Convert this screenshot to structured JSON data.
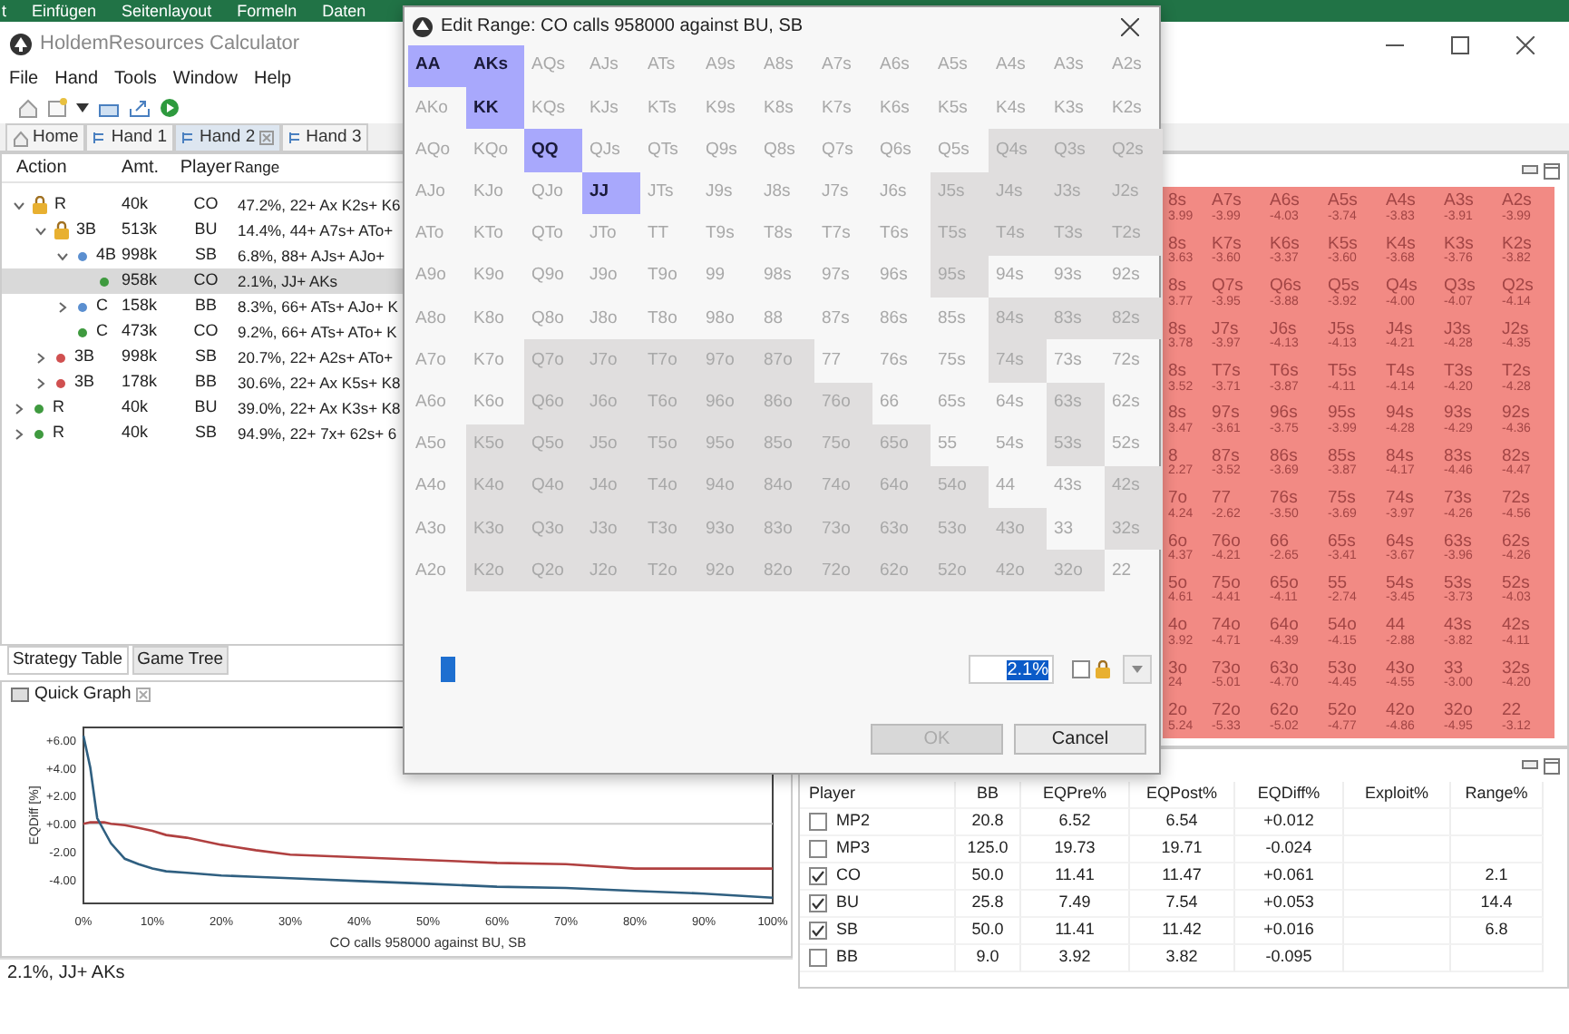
{
  "excel_ribbon": {
    "tabs": [
      "t",
      "Einfügen",
      "Seitenlayout",
      "Formeln",
      "Daten"
    ]
  },
  "window": {
    "title": "HoldemResources Calculator"
  },
  "menu": [
    "File",
    "Hand",
    "Tools",
    "Window",
    "Help"
  ],
  "tabs": [
    {
      "label": "Home",
      "kind": "home",
      "selected": false
    },
    {
      "label": "Hand 1",
      "kind": "hand",
      "selected": false
    },
    {
      "label": "Hand 2",
      "kind": "hand",
      "selected": true
    },
    {
      "label": "Hand 3",
      "kind": "hand",
      "selected": false
    }
  ],
  "action_tree": {
    "columns": [
      "Action",
      "Amt.",
      "Player",
      "Range"
    ],
    "rows": [
      {
        "action": "R",
        "amount": "40k",
        "player": "CO",
        "range": "47.2%, 22+ Ax K2s+ K6",
        "kind": "lock",
        "expanded": true,
        "selected": false,
        "children": [
          {
            "action": "3B",
            "amount": "513k",
            "player": "BU",
            "range": "14.4%, 44+ A7s+ ATo+",
            "kind": "lock",
            "expanded": true,
            "selected": false,
            "children": [
              {
                "action": "4B",
                "amount": "998k",
                "player": "SB",
                "range": "6.8%, 88+ AJs+ AJo+",
                "kind": "dot",
                "color": "#5b8fd0",
                "expanded": true,
                "selected": false,
                "children": [
                  {
                    "amount": "958k",
                    "player": "CO",
                    "range": "2.1%, JJ+ AKs",
                    "kind": "dot",
                    "color": "#3f9a3f",
                    "selected": true
                  }
                ]
              },
              {
                "action": "C",
                "amount": "158k",
                "player": "BB",
                "range": "8.3%, 66+ ATs+ AJo+ K",
                "kind": "dot",
                "color": "#5b8fd0",
                "expanded": false,
                "selected": false
              },
              {
                "action": "C",
                "amount": "473k",
                "player": "CO",
                "range": "9.2%, 66+ ATs+ ATo+ K",
                "kind": "dot",
                "color": "#3f9a3f",
                "selected": false
              }
            ]
          },
          {
            "action": "3B",
            "amount": "998k",
            "player": "SB",
            "range": "20.7%, 22+ A2s+ ATo+",
            "kind": "dot",
            "color": "#d05050",
            "expanded": false,
            "selected": false
          },
          {
            "action": "3B",
            "amount": "178k",
            "player": "BB",
            "range": "30.6%, 22+ Ax K5s+ K8",
            "kind": "dot",
            "color": "#d05050",
            "expanded": false,
            "selected": false
          }
        ]
      },
      {
        "action": "R",
        "amount": "40k",
        "player": "BU",
        "range": "39.0%, 22+ Ax K3s+ K8",
        "kind": "dot",
        "color": "#3f9a3f",
        "expanded": false,
        "selected": false
      },
      {
        "action": "R",
        "amount": "40k",
        "player": "SB",
        "range": "94.9%, 22+ 7x+ 62s+ 6",
        "kind": "dot",
        "color": "#3f9a3f",
        "expanded": false,
        "selected": false
      }
    ]
  },
  "bottom_tabs": [
    {
      "label": "Strategy Table",
      "selected": true
    },
    {
      "label": "Game Tree",
      "selected": false
    }
  ],
  "quick_graph": {
    "title": "Quick Graph",
    "chart_data": {
      "type": "line",
      "xlabel": "CO calls 958000 against BU, SB",
      "ylabel": "EQDiff [%]",
      "x": [
        0,
        1,
        2,
        3,
        4,
        6,
        8,
        10,
        12,
        15,
        20,
        25,
        30,
        40,
        50,
        60,
        70,
        80,
        90,
        100
      ],
      "series": [
        {
          "color": "#b04040",
          "values": [
            0,
            0.1,
            0.1,
            0.1,
            0,
            -0.1,
            -0.3,
            -0.5,
            -0.8,
            -1.0,
            -1.5,
            -1.9,
            -2.2,
            -2.4,
            -2.6,
            -2.8,
            -2.9,
            -3.2,
            -3.2,
            -3.2
          ]
        },
        {
          "color": "#2f5f80",
          "values": [
            6.3,
            4.0,
            0.4,
            -0.5,
            -1.4,
            -2.5,
            -2.9,
            -3.2,
            -3.4,
            -3.5,
            -3.7,
            -3.8,
            -3.9,
            -4.1,
            -4.3,
            -4.5,
            -4.6,
            -4.8,
            -5.0,
            -5.3
          ]
        }
      ],
      "xlim": [
        0,
        100
      ],
      "ylim": [
        -5.7,
        6.9
      ],
      "xticks": [
        {
          "value": 0,
          "label": "0%"
        },
        {
          "value": 10,
          "label": "10%"
        },
        {
          "value": 20,
          "label": "20%"
        },
        {
          "value": 30,
          "label": "30%"
        },
        {
          "value": 40,
          "label": "40%"
        },
        {
          "value": 50,
          "label": "50%"
        },
        {
          "value": 60,
          "label": "60%"
        },
        {
          "value": 70,
          "label": "70%"
        },
        {
          "value": 80,
          "label": "80%"
        },
        {
          "value": 90,
          "label": "90%"
        },
        {
          "value": 100,
          "label": "100%"
        }
      ],
      "yticks": [
        {
          "value": 6,
          "label": "+6.00"
        },
        {
          "value": 4,
          "label": "+4.00"
        },
        {
          "value": 2,
          "label": "+2.00"
        },
        {
          "value": 0,
          "label": "+0.00"
        },
        {
          "value": -2,
          "label": "-2.00"
        },
        {
          "value": -4,
          "label": "-4.00"
        }
      ]
    }
  },
  "status_bar": "2.1%, JJ+ AKs",
  "ev_grid": {
    "rows": [
      [
        {
          "hand": "8s",
          "value": "3.99"
        },
        {
          "hand": "A7s",
          "value": "-3.99"
        },
        {
          "hand": "A6s",
          "value": "-4.03"
        },
        {
          "hand": "A5s",
          "value": "-3.74"
        },
        {
          "hand": "A4s",
          "value": "-3.83"
        },
        {
          "hand": "A3s",
          "value": "-3.91"
        },
        {
          "hand": "A2s",
          "value": "-3.99"
        }
      ],
      [
        {
          "hand": "8s",
          "value": "3.63"
        },
        {
          "hand": "K7s",
          "value": "-3.60"
        },
        {
          "hand": "K6s",
          "value": "-3.37"
        },
        {
          "hand": "K5s",
          "value": "-3.60"
        },
        {
          "hand": "K4s",
          "value": "-3.68"
        },
        {
          "hand": "K3s",
          "value": "-3.76"
        },
        {
          "hand": "K2s",
          "value": "-3.82"
        }
      ],
      [
        {
          "hand": "8s",
          "value": "3.77"
        },
        {
          "hand": "Q7s",
          "value": "-3.95"
        },
        {
          "hand": "Q6s",
          "value": "-3.88"
        },
        {
          "hand": "Q5s",
          "value": "-3.92"
        },
        {
          "hand": "Q4s",
          "value": "-4.00"
        },
        {
          "hand": "Q3s",
          "value": "-4.07"
        },
        {
          "hand": "Q2s",
          "value": "-4.14"
        }
      ],
      [
        {
          "hand": "8s",
          "value": "3.78"
        },
        {
          "hand": "J7s",
          "value": "-3.97"
        },
        {
          "hand": "J6s",
          "value": "-4.13"
        },
        {
          "hand": "J5s",
          "value": "-4.13"
        },
        {
          "hand": "J4s",
          "value": "-4.21"
        },
        {
          "hand": "J3s",
          "value": "-4.28"
        },
        {
          "hand": "J2s",
          "value": "-4.35"
        }
      ],
      [
        {
          "hand": "8s",
          "value": "3.52"
        },
        {
          "hand": "T7s",
          "value": "-3.71"
        },
        {
          "hand": "T6s",
          "value": "-3.87"
        },
        {
          "hand": "T5s",
          "value": "-4.11"
        },
        {
          "hand": "T4s",
          "value": "-4.14"
        },
        {
          "hand": "T3s",
          "value": "-4.20"
        },
        {
          "hand": "T2s",
          "value": "-4.28"
        }
      ],
      [
        {
          "hand": "8s",
          "value": "3.47"
        },
        {
          "hand": "97s",
          "value": "-3.61"
        },
        {
          "hand": "96s",
          "value": "-3.75"
        },
        {
          "hand": "95s",
          "value": "-3.99"
        },
        {
          "hand": "94s",
          "value": "-4.28"
        },
        {
          "hand": "93s",
          "value": "-4.29"
        },
        {
          "hand": "92s",
          "value": "-4.36"
        }
      ],
      [
        {
          "hand": "8",
          "value": "2.27"
        },
        {
          "hand": "87s",
          "value": "-3.52"
        },
        {
          "hand": "86s",
          "value": "-3.69"
        },
        {
          "hand": "85s",
          "value": "-3.87"
        },
        {
          "hand": "84s",
          "value": "-4.17"
        },
        {
          "hand": "83s",
          "value": "-4.46"
        },
        {
          "hand": "82s",
          "value": "-4.47"
        }
      ],
      [
        {
          "hand": "7o",
          "value": "4.24"
        },
        {
          "hand": "77",
          "value": "-2.62"
        },
        {
          "hand": "76s",
          "value": "-3.50"
        },
        {
          "hand": "75s",
          "value": "-3.69"
        },
        {
          "hand": "74s",
          "value": "-3.97"
        },
        {
          "hand": "73s",
          "value": "-4.26"
        },
        {
          "hand": "72s",
          "value": "-4.56"
        }
      ],
      [
        {
          "hand": "6o",
          "value": "4.37"
        },
        {
          "hand": "76o",
          "value": "-4.21"
        },
        {
          "hand": "66",
          "value": "-2.65"
        },
        {
          "hand": "65s",
          "value": "-3.41"
        },
        {
          "hand": "64s",
          "value": "-3.67"
        },
        {
          "hand": "63s",
          "value": "-3.96"
        },
        {
          "hand": "62s",
          "value": "-4.26"
        }
      ],
      [
        {
          "hand": "5o",
          "value": "4.61"
        },
        {
          "hand": "75o",
          "value": "-4.41"
        },
        {
          "hand": "65o",
          "value": "-4.11"
        },
        {
          "hand": "55",
          "value": "-2.74"
        },
        {
          "hand": "54s",
          "value": "-3.45"
        },
        {
          "hand": "53s",
          "value": "-3.73"
        },
        {
          "hand": "52s",
          "value": "-4.03"
        }
      ],
      [
        {
          "hand": "4o",
          "value": "3.92"
        },
        {
          "hand": "74o",
          "value": "-4.71"
        },
        {
          "hand": "64o",
          "value": "-4.39"
        },
        {
          "hand": "54o",
          "value": "-4.15"
        },
        {
          "hand": "44",
          "value": "-2.88"
        },
        {
          "hand": "43s",
          "value": "-3.82"
        },
        {
          "hand": "42s",
          "value": "-4.11"
        }
      ],
      [
        {
          "hand": "3o",
          "value": "24"
        },
        {
          "hand": "73o",
          "value": "-5.01"
        },
        {
          "hand": "63o",
          "value": "-4.70"
        },
        {
          "hand": "53o",
          "value": "-4.45"
        },
        {
          "hand": "43o",
          "value": "-4.55"
        },
        {
          "hand": "33",
          "value": "-3.00"
        },
        {
          "hand": "32s",
          "value": "-4.20"
        }
      ],
      [
        {
          "hand": "2o",
          "value": "5.24"
        },
        {
          "hand": "72o",
          "value": "-5.33"
        },
        {
          "hand": "62o",
          "value": "-5.02"
        },
        {
          "hand": "52o",
          "value": "-4.77"
        },
        {
          "hand": "42o",
          "value": "-4.86"
        },
        {
          "hand": "32o",
          "value": "-4.95"
        },
        {
          "hand": "22",
          "value": "-3.12"
        }
      ]
    ]
  },
  "player_table": {
    "columns": [
      "Player",
      "BB",
      "EQPre%",
      "EQPost%",
      "EQDiff%",
      "Exploit%",
      "Range%"
    ],
    "rows": [
      {
        "checked": false,
        "player": "MP2",
        "bb": "20.8",
        "eq_pre": "6.52",
        "eq_post": "6.54",
        "eq_diff": "+0.012"
      },
      {
        "checked": false,
        "player": "MP3",
        "bb": "125.0",
        "eq_pre": "19.73",
        "eq_post": "19.71",
        "eq_diff": "-0.024"
      },
      {
        "checked": true,
        "player": "CO",
        "bb": "50.0",
        "eq_pre": "11.41",
        "eq_post": "11.47",
        "eq_diff": "+0.061",
        "range_pct": "2.1"
      },
      {
        "checked": true,
        "player": "BU",
        "bb": "25.8",
        "eq_pre": "7.49",
        "eq_post": "7.54",
        "eq_diff": "+0.053",
        "range_pct": "14.4"
      },
      {
        "checked": true,
        "player": "SB",
        "bb": "50.0",
        "eq_pre": "11.41",
        "eq_post": "11.42",
        "eq_diff": "+0.016",
        "range_pct": "6.8"
      },
      {
        "checked": false,
        "player": "BB",
        "bb": "9.0",
        "eq_pre": "3.92",
        "eq_post": "3.82",
        "eq_diff": "-0.095"
      }
    ]
  },
  "dialog": {
    "title": "Edit Range: CO calls 958000 against BU, SB",
    "grid": [
      [
        {
          "hand": "AA",
          "selected": true,
          "shaded": false
        },
        {
          "hand": "AKs",
          "selected": true,
          "shaded": false
        },
        {
          "hand": "AQs",
          "selected": false,
          "shaded": false
        },
        {
          "hand": "AJs",
          "selected": false,
          "shaded": false
        },
        {
          "hand": "ATs",
          "selected": false,
          "shaded": false
        },
        {
          "hand": "A9s",
          "selected": false,
          "shaded": false
        },
        {
          "hand": "A8s",
          "selected": false,
          "shaded": false
        },
        {
          "hand": "A7s",
          "selected": false,
          "shaded": false
        },
        {
          "hand": "A6s",
          "selected": false,
          "shaded": false
        },
        {
          "hand": "A5s",
          "selected": false,
          "shaded": false
        },
        {
          "hand": "A4s",
          "selected": false,
          "shaded": false
        },
        {
          "hand": "A3s",
          "selected": false,
          "shaded": false
        },
        {
          "hand": "A2s",
          "selected": false,
          "shaded": false
        }
      ],
      [
        {
          "hand": "AKo",
          "selected": false,
          "shaded": false
        },
        {
          "hand": "KK",
          "selected": true,
          "shaded": false
        },
        {
          "hand": "KQs",
          "selected": false,
          "shaded": false
        },
        {
          "hand": "KJs",
          "selected": false,
          "shaded": false
        },
        {
          "hand": "KTs",
          "selected": false,
          "shaded": false
        },
        {
          "hand": "K9s",
          "selected": false,
          "shaded": false
        },
        {
          "hand": "K8s",
          "selected": false,
          "shaded": false
        },
        {
          "hand": "K7s",
          "selected": false,
          "shaded": false
        },
        {
          "hand": "K6s",
          "selected": false,
          "shaded": false
        },
        {
          "hand": "K5s",
          "selected": false,
          "shaded": false
        },
        {
          "hand": "K4s",
          "selected": false,
          "shaded": false
        },
        {
          "hand": "K3s",
          "selected": false,
          "shaded": false
        },
        {
          "hand": "K2s",
          "selected": false,
          "shaded": false
        }
      ],
      [
        {
          "hand": "AQo",
          "selected": false,
          "shaded": false
        },
        {
          "hand": "KQo",
          "selected": false,
          "shaded": false
        },
        {
          "hand": "QQ",
          "selected": true,
          "shaded": false
        },
        {
          "hand": "QJs",
          "selected": false,
          "shaded": false
        },
        {
          "hand": "QTs",
          "selected": false,
          "shaded": false
        },
        {
          "hand": "Q9s",
          "selected": false,
          "shaded": false
        },
        {
          "hand": "Q8s",
          "selected": false,
          "shaded": false
        },
        {
          "hand": "Q7s",
          "selected": false,
          "shaded": false
        },
        {
          "hand": "Q6s",
          "selected": false,
          "shaded": false
        },
        {
          "hand": "Q5s",
          "selected": false,
          "shaded": false
        },
        {
          "hand": "Q4s",
          "selected": false,
          "shaded": true
        },
        {
          "hand": "Q3s",
          "selected": false,
          "shaded": true
        },
        {
          "hand": "Q2s",
          "selected": false,
          "shaded": true
        }
      ],
      [
        {
          "hand": "AJo",
          "selected": false,
          "shaded": false
        },
        {
          "hand": "KJo",
          "selected": false,
          "shaded": false
        },
        {
          "hand": "QJo",
          "selected": false,
          "shaded": false
        },
        {
          "hand": "JJ",
          "selected": true,
          "shaded": false
        },
        {
          "hand": "JTs",
          "selected": false,
          "shaded": false
        },
        {
          "hand": "J9s",
          "selected": false,
          "shaded": false
        },
        {
          "hand": "J8s",
          "selected": false,
          "shaded": false
        },
        {
          "hand": "J7s",
          "selected": false,
          "shaded": false
        },
        {
          "hand": "J6s",
          "selected": false,
          "shaded": false
        },
        {
          "hand": "J5s",
          "selected": false,
          "shaded": true
        },
        {
          "hand": "J4s",
          "selected": false,
          "shaded": true
        },
        {
          "hand": "J3s",
          "selected": false,
          "shaded": true
        },
        {
          "hand": "J2s",
          "selected": false,
          "shaded": true
        }
      ],
      [
        {
          "hand": "ATo",
          "selected": false,
          "shaded": false
        },
        {
          "hand": "KTo",
          "selected": false,
          "shaded": false
        },
        {
          "hand": "QTo",
          "selected": false,
          "shaded": false
        },
        {
          "hand": "JTo",
          "selected": false,
          "shaded": false
        },
        {
          "hand": "TT",
          "selected": false,
          "shaded": false
        },
        {
          "hand": "T9s",
          "selected": false,
          "shaded": false
        },
        {
          "hand": "T8s",
          "selected": false,
          "shaded": false
        },
        {
          "hand": "T7s",
          "selected": false,
          "shaded": false
        },
        {
          "hand": "T6s",
          "selected": false,
          "shaded": false
        },
        {
          "hand": "T5s",
          "selected": false,
          "shaded": true
        },
        {
          "hand": "T4s",
          "selected": false,
          "shaded": true
        },
        {
          "hand": "T3s",
          "selected": false,
          "shaded": true
        },
        {
          "hand": "T2s",
          "selected": false,
          "shaded": true
        }
      ],
      [
        {
          "hand": "A9o",
          "selected": false,
          "shaded": false
        },
        {
          "hand": "K9o",
          "selected": false,
          "shaded": false
        },
        {
          "hand": "Q9o",
          "selected": false,
          "shaded": false
        },
        {
          "hand": "J9o",
          "selected": false,
          "shaded": false
        },
        {
          "hand": "T9o",
          "selected": false,
          "shaded": false
        },
        {
          "hand": "99",
          "selected": false,
          "shaded": false
        },
        {
          "hand": "98s",
          "selected": false,
          "shaded": false
        },
        {
          "hand": "97s",
          "selected": false,
          "shaded": false
        },
        {
          "hand": "96s",
          "selected": false,
          "shaded": false
        },
        {
          "hand": "95s",
          "selected": false,
          "shaded": true
        },
        {
          "hand": "94s",
          "selected": false,
          "shaded": false
        },
        {
          "hand": "93s",
          "selected": false,
          "shaded": false
        },
        {
          "hand": "92s",
          "selected": false,
          "shaded": false
        }
      ],
      [
        {
          "hand": "A8o",
          "selected": false,
          "shaded": false
        },
        {
          "hand": "K8o",
          "selected": false,
          "shaded": false
        },
        {
          "hand": "Q8o",
          "selected": false,
          "shaded": false
        },
        {
          "hand": "J8o",
          "selected": false,
          "shaded": false
        },
        {
          "hand": "T8o",
          "selected": false,
          "shaded": false
        },
        {
          "hand": "98o",
          "selected": false,
          "shaded": false
        },
        {
          "hand": "88",
          "selected": false,
          "shaded": false
        },
        {
          "hand": "87s",
          "selected": false,
          "shaded": false
        },
        {
          "hand": "86s",
          "selected": false,
          "shaded": false
        },
        {
          "hand": "85s",
          "selected": false,
          "shaded": false
        },
        {
          "hand": "84s",
          "selected": false,
          "shaded": true
        },
        {
          "hand": "83s",
          "selected": false,
          "shaded": true
        },
        {
          "hand": "82s",
          "selected": false,
          "shaded": true
        }
      ],
      [
        {
          "hand": "A7o",
          "selected": false,
          "shaded": false
        },
        {
          "hand": "K7o",
          "selected": false,
          "shaded": false
        },
        {
          "hand": "Q7o",
          "selected": false,
          "shaded": true
        },
        {
          "hand": "J7o",
          "selected": false,
          "shaded": true
        },
        {
          "hand": "T7o",
          "selected": false,
          "shaded": true
        },
        {
          "hand": "97o",
          "selected": false,
          "shaded": true
        },
        {
          "hand": "87o",
          "selected": false,
          "shaded": true
        },
        {
          "hand": "77",
          "selected": false,
          "shaded": false
        },
        {
          "hand": "76s",
          "selected": false,
          "shaded": false
        },
        {
          "hand": "75s",
          "selected": false,
          "shaded": false
        },
        {
          "hand": "74s",
          "selected": false,
          "shaded": true
        },
        {
          "hand": "73s",
          "selected": false,
          "shaded": false
        },
        {
          "hand": "72s",
          "selected": false,
          "shaded": false
        }
      ],
      [
        {
          "hand": "A6o",
          "selected": false,
          "shaded": false
        },
        {
          "hand": "K6o",
          "selected": false,
          "shaded": false
        },
        {
          "hand": "Q6o",
          "selected": false,
          "shaded": true
        },
        {
          "hand": "J6o",
          "selected": false,
          "shaded": true
        },
        {
          "hand": "T6o",
          "selected": false,
          "shaded": true
        },
        {
          "hand": "96o",
          "selected": false,
          "shaded": true
        },
        {
          "hand": "86o",
          "selected": false,
          "shaded": true
        },
        {
          "hand": "76o",
          "selected": false,
          "shaded": true
        },
        {
          "hand": "66",
          "selected": false,
          "shaded": false
        },
        {
          "hand": "65s",
          "selected": false,
          "shaded": false
        },
        {
          "hand": "64s",
          "selected": false,
          "shaded": false
        },
        {
          "hand": "63s",
          "selected": false,
          "shaded": true
        },
        {
          "hand": "62s",
          "selected": false,
          "shaded": false
        }
      ],
      [
        {
          "hand": "A5o",
          "selected": false,
          "shaded": false
        },
        {
          "hand": "K5o",
          "selected": false,
          "shaded": true
        },
        {
          "hand": "Q5o",
          "selected": false,
          "shaded": true
        },
        {
          "hand": "J5o",
          "selected": false,
          "shaded": true
        },
        {
          "hand": "T5o",
          "selected": false,
          "shaded": true
        },
        {
          "hand": "95o",
          "selected": false,
          "shaded": true
        },
        {
          "hand": "85o",
          "selected": false,
          "shaded": true
        },
        {
          "hand": "75o",
          "selected": false,
          "shaded": true
        },
        {
          "hand": "65o",
          "selected": false,
          "shaded": true
        },
        {
          "hand": "55",
          "selected": false,
          "shaded": false
        },
        {
          "hand": "54s",
          "selected": false,
          "shaded": false
        },
        {
          "hand": "53s",
          "selected": false,
          "shaded": true
        },
        {
          "hand": "52s",
          "selected": false,
          "shaded": false
        }
      ],
      [
        {
          "hand": "A4o",
          "selected": false,
          "shaded": false
        },
        {
          "hand": "K4o",
          "selected": false,
          "shaded": true
        },
        {
          "hand": "Q4o",
          "selected": false,
          "shaded": true
        },
        {
          "hand": "J4o",
          "selected": false,
          "shaded": true
        },
        {
          "hand": "T4o",
          "selected": false,
          "shaded": true
        },
        {
          "hand": "94o",
          "selected": false,
          "shaded": true
        },
        {
          "hand": "84o",
          "selected": false,
          "shaded": true
        },
        {
          "hand": "74o",
          "selected": false,
          "shaded": true
        },
        {
          "hand": "64o",
          "selected": false,
          "shaded": true
        },
        {
          "hand": "54o",
          "selected": false,
          "shaded": true
        },
        {
          "hand": "44",
          "selected": false,
          "shaded": false
        },
        {
          "hand": "43s",
          "selected": false,
          "shaded": false
        },
        {
          "hand": "42s",
          "selected": false,
          "shaded": true
        }
      ],
      [
        {
          "hand": "A3o",
          "selected": false,
          "shaded": false
        },
        {
          "hand": "K3o",
          "selected": false,
          "shaded": true
        },
        {
          "hand": "Q3o",
          "selected": false,
          "shaded": true
        },
        {
          "hand": "J3o",
          "selected": false,
          "shaded": true
        },
        {
          "hand": "T3o",
          "selected": false,
          "shaded": true
        },
        {
          "hand": "93o",
          "selected": false,
          "shaded": true
        },
        {
          "hand": "83o",
          "selected": false,
          "shaded": true
        },
        {
          "hand": "73o",
          "selected": false,
          "shaded": true
        },
        {
          "hand": "63o",
          "selected": false,
          "shaded": true
        },
        {
          "hand": "53o",
          "selected": false,
          "shaded": true
        },
        {
          "hand": "43o",
          "selected": false,
          "shaded": true
        },
        {
          "hand": "33",
          "selected": false,
          "shaded": false
        },
        {
          "hand": "32s",
          "selected": false,
          "shaded": true
        }
      ],
      [
        {
          "hand": "A2o",
          "selected": false,
          "shaded": false
        },
        {
          "hand": "K2o",
          "selected": false,
          "shaded": true
        },
        {
          "hand": "Q2o",
          "selected": false,
          "shaded": true
        },
        {
          "hand": "J2o",
          "selected": false,
          "shaded": true
        },
        {
          "hand": "T2o",
          "selected": false,
          "shaded": true
        },
        {
          "hand": "92o",
          "selected": false,
          "shaded": true
        },
        {
          "hand": "82o",
          "selected": false,
          "shaded": true
        },
        {
          "hand": "72o",
          "selected": false,
          "shaded": true
        },
        {
          "hand": "62o",
          "selected": false,
          "shaded": true
        },
        {
          "hand": "52o",
          "selected": false,
          "shaded": true
        },
        {
          "hand": "42o",
          "selected": false,
          "shaded": true
        },
        {
          "hand": "32o",
          "selected": false,
          "shaded": true
        },
        {
          "hand": "22",
          "selected": false,
          "shaded": false
        }
      ]
    ],
    "slider": {
      "level": 0.02
    },
    "percent_field": {
      "value": "2.1%"
    },
    "lock_checkbox": {
      "checked": false
    },
    "buttons": [
      {
        "label": "OK",
        "disabled": true
      },
      {
        "label": "Cancel",
        "disabled": false
      }
    ]
  }
}
